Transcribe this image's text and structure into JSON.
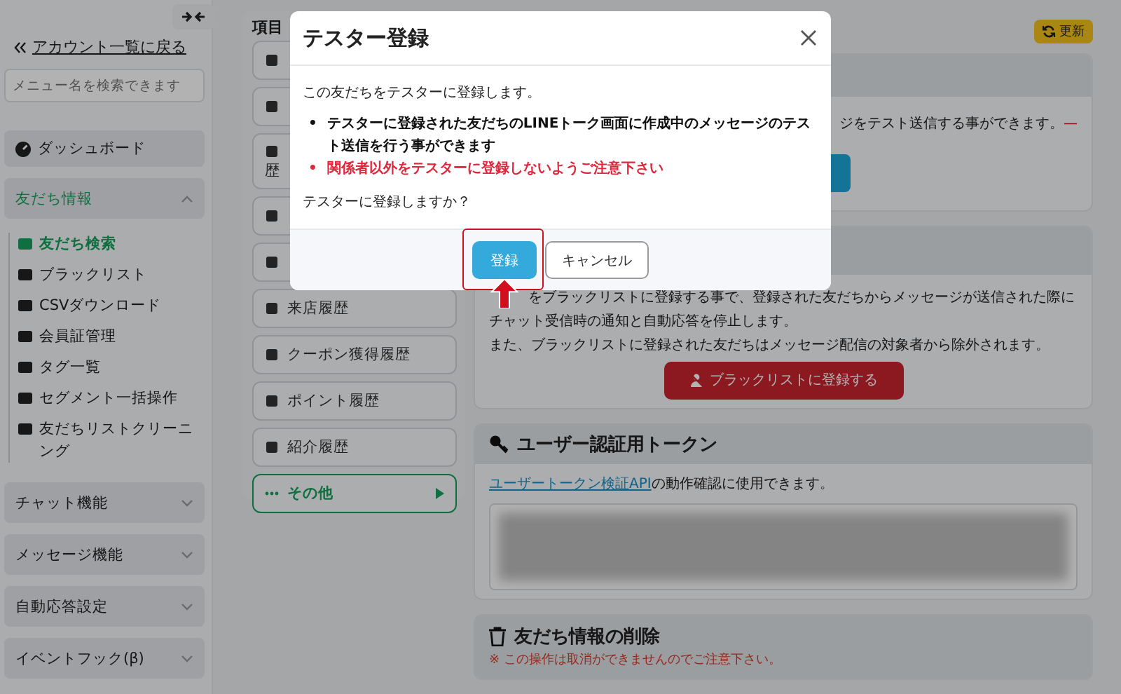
{
  "sidebar": {
    "back_link": "アカウント一覧に戻る",
    "search": {
      "placeholder": "メニュー名を検索できます"
    },
    "sections": [
      {
        "label": "ダッシュボード",
        "kind": "link"
      },
      {
        "label": "友だち情報",
        "kind": "group",
        "expanded": true,
        "items": [
          {
            "label": "友だち検索",
            "selected": true
          },
          {
            "label": "ブラックリスト",
            "selected": false
          },
          {
            "label": "CSVダウンロード",
            "selected": false
          },
          {
            "label": "会員証管理",
            "selected": false
          },
          {
            "label": "タグ一覧",
            "selected": false
          },
          {
            "label": "セグメント一括操作",
            "selected": false
          },
          {
            "label": "友だちリストクリーニング",
            "selected": false
          }
        ]
      },
      {
        "label": "チャット機能",
        "kind": "group",
        "expanded": false
      },
      {
        "label": "メッセージ機能",
        "kind": "group",
        "expanded": false
      },
      {
        "label": "自動応答設定",
        "kind": "group",
        "expanded": false
      },
      {
        "label": "イベントフック(β)",
        "kind": "group",
        "expanded": false
      }
    ]
  },
  "items_panel": {
    "title": "項目",
    "buttons": [
      {
        "selected": false
      },
      {
        "selected": false
      },
      {
        "label": "歴",
        "selected": false
      },
      {
        "selected": false
      },
      {
        "selected": false
      },
      {
        "label": "来店履歴",
        "selected": false
      },
      {
        "label": "クーポン獲得履歴",
        "selected": false
      },
      {
        "label": "ポイント履歴",
        "selected": false
      },
      {
        "label": "紹介履歴",
        "selected": false
      },
      {
        "label": "その他",
        "selected": true
      }
    ]
  },
  "refresh_button": {
    "label": "更新"
  },
  "tester_card": {
    "text": "ジをテスト送信する事ができます。",
    "tail": "—"
  },
  "blacklist_card": {
    "lines": [
      "をブラックリストに登録する事で、登録された友だちからメッセージが送信された際に",
      "チャット受信時の通知と自動応答を停止します。",
      "また、ブラックリストに登録された友だちはメッセージ配信の対象者から除外されます。"
    ],
    "button": "ブラックリストに登録する"
  },
  "token_card": {
    "title": "ユーザー認証用トークン",
    "link": "ユーザートークン検証API",
    "text": "の動作確認に使用できます。"
  },
  "delete_card": {
    "title": "友だち情報の削除",
    "warning": "※ この操作は取消ができませんのでご注意下さい。"
  },
  "modal": {
    "title": "テスター登録",
    "intro": "この友だちをテスターに登録します。",
    "bullets": [
      {
        "marker": "•",
        "text": "テスターに登録された友だちのLINEトーク画面に作成中のメッセージのテスト送信を行う事ができます",
        "kind": "note"
      },
      {
        "marker": "•",
        "text": "関係者以外をテスターに登録しないようご注意下さい",
        "kind": "warning"
      }
    ],
    "question": "テスターに登録しますか？",
    "buttons": [
      {
        "label": "登録",
        "kind": "primary",
        "highlighted": true
      },
      {
        "label": "キャンセル",
        "kind": "secondary",
        "highlighted": false
      }
    ]
  }
}
